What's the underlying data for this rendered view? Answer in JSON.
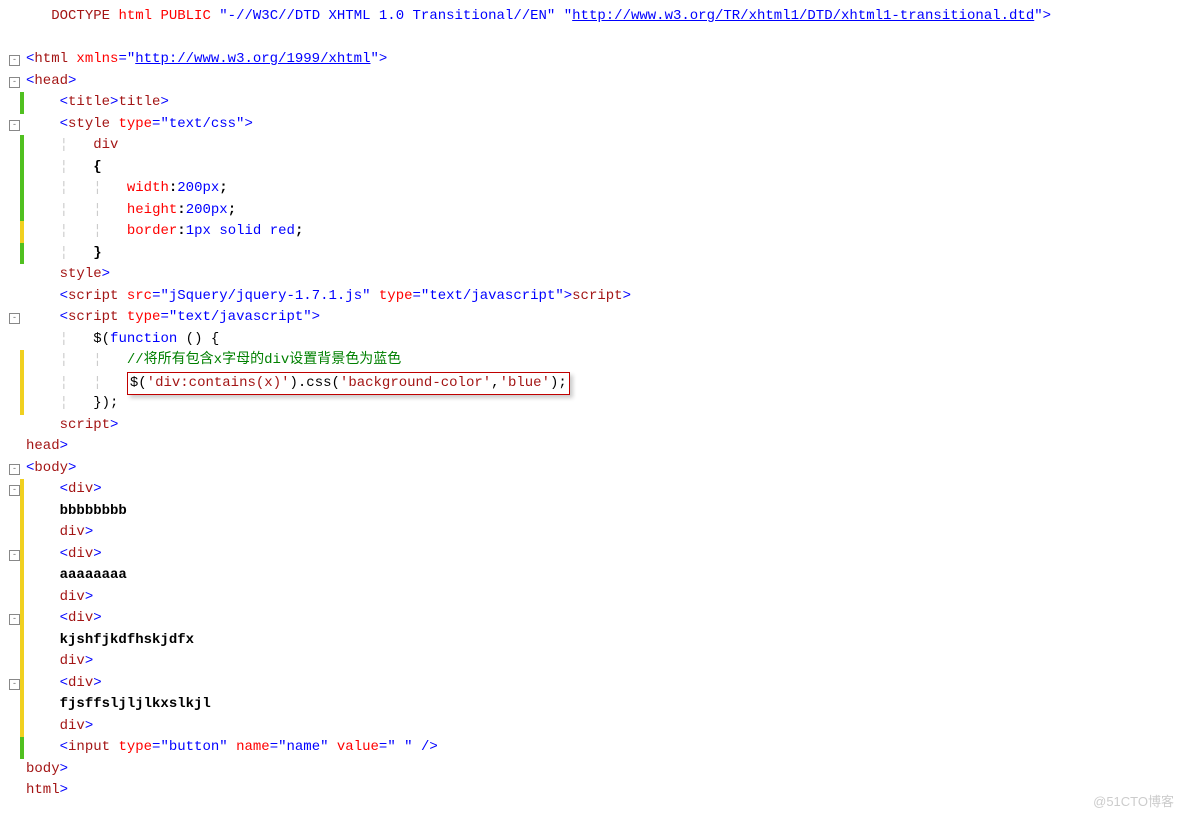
{
  "watermark": "@51CTO博客",
  "lines": [
    {
      "fold": "",
      "bar": "",
      "indent": "   ",
      "seg": [
        {
          "c": "t-blue",
          "t": "<!"
        },
        {
          "c": "t-brown",
          "t": "DOCTYPE"
        },
        {
          "c": "",
          "t": " "
        },
        {
          "c": "t-red",
          "t": "html"
        },
        {
          "c": "",
          "t": " "
        },
        {
          "c": "t-red",
          "t": "PUBLIC"
        },
        {
          "c": "",
          "t": " "
        },
        {
          "c": "t-blue",
          "t": "\"-//W3C//DTD XHTML 1.0 Transitional//EN\""
        },
        {
          "c": "",
          "t": " "
        },
        {
          "c": "t-blue",
          "t": "\""
        },
        {
          "c": "t-link",
          "t": "http://www.w3.org/TR/xhtml1/DTD/xhtml1-transitional.dtd",
          "href": "#"
        },
        {
          "c": "t-blue",
          "t": "\""
        },
        {
          "c": "t-blue",
          "t": ">"
        }
      ]
    },
    {
      "fold": "",
      "bar": "",
      "indent": "",
      "seg": []
    },
    {
      "fold": "-",
      "bar": "",
      "indent": "",
      "seg": [
        {
          "c": "t-blue",
          "t": "<"
        },
        {
          "c": "t-brown",
          "t": "html"
        },
        {
          "c": "",
          "t": " "
        },
        {
          "c": "t-red",
          "t": "xmlns"
        },
        {
          "c": "t-blue",
          "t": "="
        },
        {
          "c": "t-blue",
          "t": "\""
        },
        {
          "c": "t-link",
          "t": "http://www.w3.org/1999/xhtml",
          "href": "#"
        },
        {
          "c": "t-blue",
          "t": "\""
        },
        {
          "c": "t-blue",
          "t": ">"
        }
      ]
    },
    {
      "fold": "-",
      "bar": "",
      "indent": "",
      "seg": [
        {
          "c": "t-blue",
          "t": "<"
        },
        {
          "c": "t-brown",
          "t": "head"
        },
        {
          "c": "t-blue",
          "t": ">"
        }
      ]
    },
    {
      "fold": "",
      "bar": "cb-green",
      "indent": "    ",
      "seg": [
        {
          "c": "t-blue",
          "t": "<"
        },
        {
          "c": "t-brown",
          "t": "title"
        },
        {
          "c": "t-blue",
          "t": "></"
        },
        {
          "c": "t-brown",
          "t": "title"
        },
        {
          "c": "t-blue",
          "t": ">"
        }
      ]
    },
    {
      "fold": "-",
      "bar": "",
      "indent": "    ",
      "seg": [
        {
          "c": "t-blue",
          "t": "<"
        },
        {
          "c": "t-brown",
          "t": "style"
        },
        {
          "c": "",
          "t": " "
        },
        {
          "c": "t-red",
          "t": "type"
        },
        {
          "c": "t-blue",
          "t": "=\"text/css\">"
        }
      ]
    },
    {
      "fold": "",
      "bar": "cb-green",
      "indent": "        ",
      "seg": [
        {
          "c": "t-brown",
          "t": "div"
        }
      ]
    },
    {
      "fold": "",
      "bar": "cb-green",
      "indent": "        ",
      "seg": [
        {
          "c": "t-bold",
          "t": "{"
        }
      ]
    },
    {
      "fold": "",
      "bar": "cb-green",
      "indent": "            ",
      "seg": [
        {
          "c": "t-red",
          "t": "width"
        },
        {
          "c": "t-bold",
          "t": ":"
        },
        {
          "c": "t-blue",
          "t": "200px"
        },
        {
          "c": "t-bold",
          "t": ";"
        }
      ]
    },
    {
      "fold": "",
      "bar": "cb-green",
      "indent": "            ",
      "seg": [
        {
          "c": "t-red",
          "t": "height"
        },
        {
          "c": "t-bold",
          "t": ":"
        },
        {
          "c": "t-blue",
          "t": "200px"
        },
        {
          "c": "t-bold",
          "t": ";"
        }
      ]
    },
    {
      "fold": "",
      "bar": "cb-yellow",
      "indent": "            ",
      "seg": [
        {
          "c": "t-red",
          "t": "border"
        },
        {
          "c": "t-bold",
          "t": ":"
        },
        {
          "c": "t-blue",
          "t": "1px"
        },
        {
          "c": "",
          "t": " "
        },
        {
          "c": "t-blue",
          "t": "solid"
        },
        {
          "c": "",
          "t": " "
        },
        {
          "c": "t-blue",
          "t": "red"
        },
        {
          "c": "t-bold",
          "t": ";"
        }
      ]
    },
    {
      "fold": "",
      "bar": "cb-green",
      "indent": "        ",
      "seg": [
        {
          "c": "t-bold",
          "t": "}"
        }
      ]
    },
    {
      "fold": "",
      "bar": "",
      "indent": "    ",
      "seg": [
        {
          "c": "t-blue",
          "t": "</"
        },
        {
          "c": "t-brown",
          "t": "style"
        },
        {
          "c": "t-blue",
          "t": ">"
        }
      ]
    },
    {
      "fold": "",
      "bar": "",
      "indent": "    ",
      "seg": [
        {
          "c": "t-blue",
          "t": "<"
        },
        {
          "c": "t-brown",
          "t": "script"
        },
        {
          "c": "",
          "t": " "
        },
        {
          "c": "t-red",
          "t": "src"
        },
        {
          "c": "t-blue",
          "t": "=\"jSquery/jquery-1.7.1.js\""
        },
        {
          "c": "",
          "t": " "
        },
        {
          "c": "t-red",
          "t": "type"
        },
        {
          "c": "t-blue",
          "t": "=\"text/javascript\"></"
        },
        {
          "c": "t-brown",
          "t": "script"
        },
        {
          "c": "t-blue",
          "t": ">"
        }
      ]
    },
    {
      "fold": "-",
      "bar": "",
      "indent": "    ",
      "seg": [
        {
          "c": "t-blue",
          "t": "<"
        },
        {
          "c": "t-brown",
          "t": "script"
        },
        {
          "c": "",
          "t": " "
        },
        {
          "c": "t-red",
          "t": "type"
        },
        {
          "c": "t-blue",
          "t": "=\"text/javascript\">"
        }
      ]
    },
    {
      "fold": "",
      "bar": "",
      "indent": "        ",
      "seg": [
        {
          "c": "t-black",
          "t": "$("
        },
        {
          "c": "t-blue",
          "t": "function"
        },
        {
          "c": "t-black",
          "t": " () {"
        }
      ]
    },
    {
      "fold": "",
      "bar": "cb-yellow",
      "indent": "            ",
      "seg": [
        {
          "c": "t-green",
          "t": "//将所有包含x字母的div设置背景色为蓝色"
        }
      ]
    },
    {
      "fold": "",
      "bar": "cb-yellow",
      "indent": "            ",
      "box": true,
      "seg": [
        {
          "c": "t-black",
          "t": "$("
        },
        {
          "c": "t-brown",
          "t": "'div:contains(x)'"
        },
        {
          "c": "t-black",
          "t": ").css("
        },
        {
          "c": "t-brown",
          "t": "'background-color'"
        },
        {
          "c": "t-black",
          "t": ","
        },
        {
          "c": "t-brown",
          "t": "'blue'"
        },
        {
          "c": "t-black",
          "t": ");"
        }
      ]
    },
    {
      "fold": "",
      "bar": "cb-yellow",
      "indent": "        ",
      "seg": [
        {
          "c": "t-black",
          "t": "});"
        }
      ]
    },
    {
      "fold": "",
      "bar": "",
      "indent": "    ",
      "seg": [
        {
          "c": "t-blue",
          "t": "</"
        },
        {
          "c": "t-brown",
          "t": "script"
        },
        {
          "c": "t-blue",
          "t": ">"
        }
      ]
    },
    {
      "fold": "",
      "bar": "",
      "indent": "",
      "seg": [
        {
          "c": "t-blue",
          "t": "</"
        },
        {
          "c": "t-brown",
          "t": "head"
        },
        {
          "c": "t-blue",
          "t": ">"
        }
      ]
    },
    {
      "fold": "-",
      "bar": "",
      "indent": "",
      "seg": [
        {
          "c": "t-blue",
          "t": "<"
        },
        {
          "c": "t-brown",
          "t": "body"
        },
        {
          "c": "t-blue",
          "t": ">"
        }
      ]
    },
    {
      "fold": "-",
      "bar": "cb-yellow",
      "indent": "    ",
      "seg": [
        {
          "c": "t-blue",
          "t": "<"
        },
        {
          "c": "t-brown",
          "t": "div"
        },
        {
          "c": "t-blue",
          "t": ">"
        }
      ]
    },
    {
      "fold": "",
      "bar": "cb-yellow",
      "indent": "    ",
      "seg": [
        {
          "c": "t-bold",
          "t": "bbbbbbbb"
        }
      ]
    },
    {
      "fold": "",
      "bar": "cb-yellow",
      "indent": "    ",
      "seg": [
        {
          "c": "t-blue",
          "t": "</"
        },
        {
          "c": "t-brown",
          "t": "div"
        },
        {
          "c": "t-blue",
          "t": ">"
        }
      ]
    },
    {
      "fold": "-",
      "bar": "cb-yellow",
      "indent": "    ",
      "seg": [
        {
          "c": "t-blue",
          "t": "<"
        },
        {
          "c": "t-brown",
          "t": "div"
        },
        {
          "c": "t-blue",
          "t": ">"
        }
      ]
    },
    {
      "fold": "",
      "bar": "cb-yellow",
      "indent": "    ",
      "seg": [
        {
          "c": "t-bold",
          "t": "aaaaaaaa"
        }
      ]
    },
    {
      "fold": "",
      "bar": "cb-yellow",
      "indent": "    ",
      "seg": [
        {
          "c": "t-blue",
          "t": "</"
        },
        {
          "c": "t-brown",
          "t": "div"
        },
        {
          "c": "t-blue",
          "t": ">"
        }
      ]
    },
    {
      "fold": "-",
      "bar": "cb-yellow",
      "indent": "    ",
      "seg": [
        {
          "c": "t-blue",
          "t": "<"
        },
        {
          "c": "t-brown",
          "t": "div"
        },
        {
          "c": "t-blue",
          "t": ">"
        }
      ]
    },
    {
      "fold": "",
      "bar": "cb-yellow",
      "indent": "    ",
      "seg": [
        {
          "c": "t-bold",
          "t": "kjshfjkdfhskjdfx"
        }
      ]
    },
    {
      "fold": "",
      "bar": "cb-yellow",
      "indent": "    ",
      "seg": [
        {
          "c": "t-blue",
          "t": "</"
        },
        {
          "c": "t-brown",
          "t": "div"
        },
        {
          "c": "t-blue",
          "t": ">"
        }
      ]
    },
    {
      "fold": "-",
      "bar": "cb-yellow",
      "indent": "    ",
      "seg": [
        {
          "c": "t-blue",
          "t": "<"
        },
        {
          "c": "t-brown",
          "t": "div"
        },
        {
          "c": "t-blue",
          "t": ">"
        }
      ]
    },
    {
      "fold": "",
      "bar": "cb-yellow",
      "indent": "    ",
      "seg": [
        {
          "c": "t-bold",
          "t": "fjsffsljljlkxslkjl"
        }
      ]
    },
    {
      "fold": "",
      "bar": "cb-yellow",
      "indent": "    ",
      "seg": [
        {
          "c": "t-blue",
          "t": "</"
        },
        {
          "c": "t-brown",
          "t": "div"
        },
        {
          "c": "t-blue",
          "t": ">"
        }
      ]
    },
    {
      "fold": "",
      "bar": "cb-green",
      "indent": "    ",
      "seg": [
        {
          "c": "t-blue",
          "t": "<"
        },
        {
          "c": "t-brown",
          "t": "input"
        },
        {
          "c": "",
          "t": " "
        },
        {
          "c": "t-red",
          "t": "type"
        },
        {
          "c": "t-blue",
          "t": "=\"button\""
        },
        {
          "c": "",
          "t": " "
        },
        {
          "c": "t-red",
          "t": "name"
        },
        {
          "c": "t-blue",
          "t": "=\"name\""
        },
        {
          "c": "",
          "t": " "
        },
        {
          "c": "t-red",
          "t": "value"
        },
        {
          "c": "t-blue",
          "t": "=\" \""
        },
        {
          "c": "",
          "t": " "
        },
        {
          "c": "t-blue",
          "t": "/>"
        }
      ]
    },
    {
      "fold": "",
      "bar": "",
      "indent": "",
      "seg": [
        {
          "c": "t-blue",
          "t": "</"
        },
        {
          "c": "t-brown",
          "t": "body"
        },
        {
          "c": "t-blue",
          "t": ">"
        }
      ]
    },
    {
      "fold": "",
      "bar": "",
      "indent": "",
      "seg": [
        {
          "c": "t-blue",
          "t": "</"
        },
        {
          "c": "t-brown",
          "t": "html"
        },
        {
          "c": "t-blue",
          "t": ">"
        }
      ]
    }
  ]
}
